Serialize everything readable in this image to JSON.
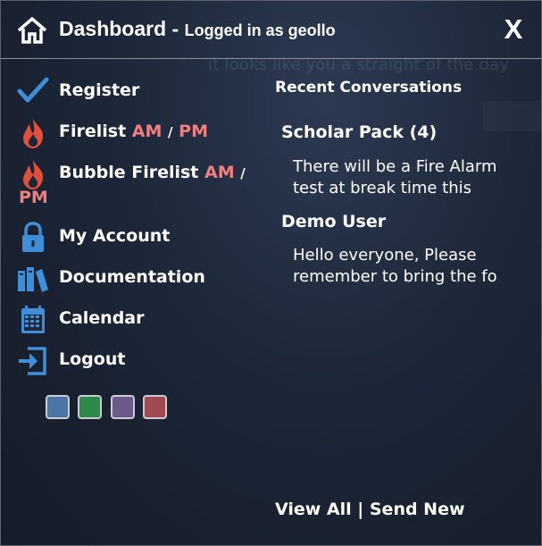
{
  "header": {
    "title": "Dashboard",
    "separator": " - ",
    "subtitle": "Logged in as geollo",
    "close_label": "X"
  },
  "background": {
    "ghost_text": "it looks like you a straight of the day"
  },
  "menu": {
    "register": "Register",
    "firelist": {
      "label": "Firelist",
      "am": "AM",
      "sep": "/",
      "pm": "PM"
    },
    "bubble_firelist": {
      "label": "Bubble Firelist",
      "am": "AM",
      "sep": "/",
      "pm": "PM"
    },
    "my_account": "My Account",
    "documentation": "Documentation",
    "calendar": "Calendar",
    "logout": "Logout"
  },
  "swatches": [
    {
      "name": "blue",
      "color": "#4a76a8"
    },
    {
      "name": "green",
      "color": "#2e8a4a"
    },
    {
      "name": "purple",
      "color": "#6e5a8a"
    },
    {
      "name": "red",
      "color": "#a04a52"
    }
  ],
  "recent": {
    "title": "Recent Conversations",
    "conversations": [
      {
        "name": "Scholar Pack (4)",
        "line1": "There will be a Fire Alarm",
        "line2": "test at break time this"
      },
      {
        "name": "Demo User",
        "line1": "Hello everyone, Please",
        "line2": "remember to bring the fo"
      }
    ]
  },
  "footer": {
    "view_all": "View All",
    "divider": "|",
    "send_new": "Send New"
  },
  "colors": {
    "accent_pink": "#f08080",
    "icon_blue": "#3f8fd8",
    "fire_red": "#e0503a"
  }
}
